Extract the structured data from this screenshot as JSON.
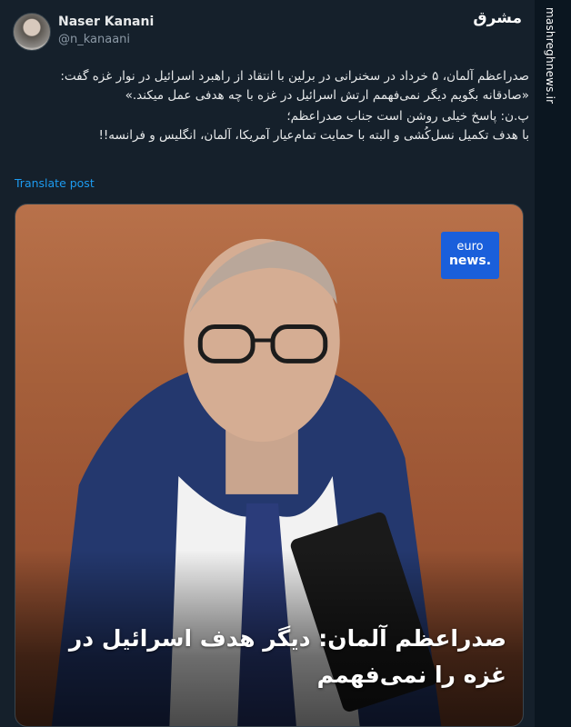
{
  "author": {
    "name": "Naser Kanani",
    "handle": "@n_kanaani"
  },
  "watermark": {
    "logo_text": "مشرق",
    "side_url": "mashreghnews.ir"
  },
  "tweet": {
    "paragraph1": "صدراعظم آلمان، ۵ خرداد در سخنرانی در برلین با انتقاد از راهبرد اسرائیل در نوار غزه گفت: «صادقانه بگویم دیگر نمی‌فهمم ارتش اسرائیل در غزه با چه هدفی عمل میکند.»",
    "paragraph2_line1": "پ.ن: پاسخ خیلی روشن است جناب صدراعظم؛",
    "paragraph2_line2": "با هدف تکمیل نسل‌کُشی و البته با حمایت تمام‌عیار آمریکا، آلمان، انگلیس و فرانسه!!",
    "translate_label": "Translate post"
  },
  "media": {
    "badge_line1": "euro",
    "badge_line2": "news.",
    "headline": "صدراعظم آلمان: دیگر هدف اسرائیل در غزه را نمی‌فهمم"
  },
  "colors": {
    "background": "#15202b",
    "link": "#1d9bf0",
    "euronews_blue": "#1a5fdb"
  }
}
